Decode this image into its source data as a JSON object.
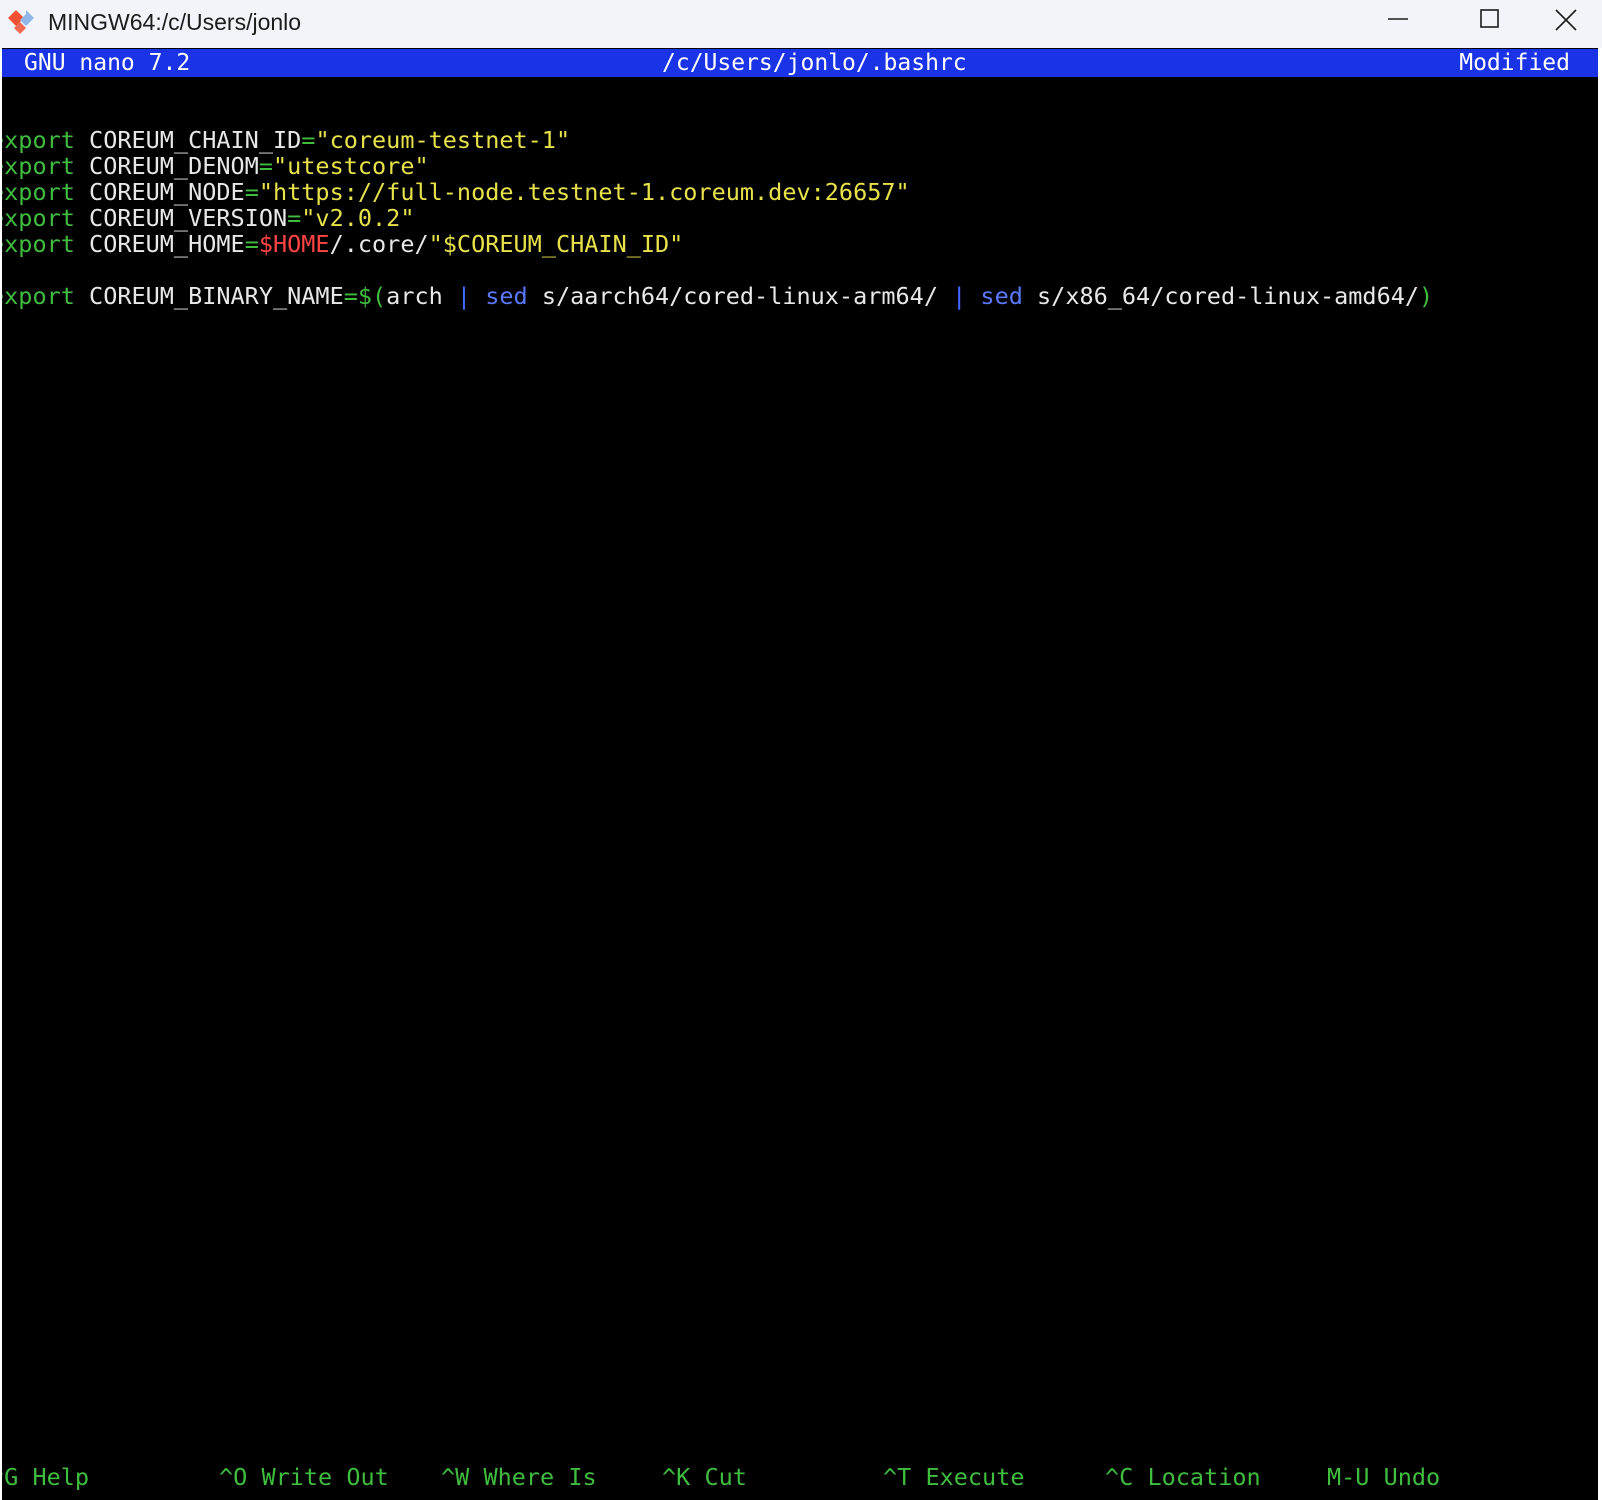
{
  "window": {
    "title": "MINGW64:/c/Users/jonlo",
    "icon": "git-bash-icon",
    "controls": {
      "minimize": "minimize-icon",
      "maximize": "maximize-icon",
      "close": "close-icon"
    }
  },
  "nano": {
    "version": "GNU nano 7.2",
    "file": "/c/Users/jonlo/.bashrc",
    "status": "Modified"
  },
  "lines": [
    {
      "kw": "export",
      "var": "COREUM_CHAIN_ID",
      "op": "=",
      "value": "\"coreum-testnet-1\""
    },
    {
      "kw": "export",
      "var": "COREUM_DENOM",
      "op": "=",
      "value": "\"utestcore\""
    },
    {
      "kw": "export",
      "var": "COREUM_NODE",
      "op": "=",
      "value": "\"https://full-node.testnet-1.coreum.dev:26657\""
    },
    {
      "kw": "export",
      "var": "COREUM_VERSION",
      "op": "=",
      "value": "\"v2.0.2\""
    },
    {
      "kw": "export",
      "var": "COREUM_HOME",
      "op": "=",
      "env": "$HOME",
      "plain": "/.core/",
      "value": "\"$COREUM_CHAIN_ID\""
    },
    {
      "kw": "export",
      "var": "COREUM_BINARY_NAME",
      "op": "=",
      "subst_open": "$(",
      "arch": "arch ",
      "pipe1": "| ",
      "sed1": "sed",
      "arg1": " s/aarch64/cored-linux-arm64/ ",
      "pipe2": "| ",
      "sed2": "sed",
      "arg2": " s/x86_64/cored-linux-amd64/",
      "subst_close": ")"
    }
  ],
  "shortcuts": [
    {
      "key": "^G",
      "label": "Help"
    },
    {
      "key": "^O",
      "label": "Write Out"
    },
    {
      "key": "^W",
      "label": "Where Is"
    },
    {
      "key": "^K",
      "label": "Cut"
    },
    {
      "key": "^T",
      "label": "Execute"
    },
    {
      "key": "^C",
      "label": "Location"
    },
    {
      "key": "M-U",
      "label": "Undo"
    }
  ],
  "colors": {
    "header_bg": "#1a33e6",
    "terminal_bg": "#000000",
    "keyword": "#3fbd3f",
    "string": "#e8e24a",
    "env_var": "#ff4444",
    "command": "#5b78ff"
  }
}
